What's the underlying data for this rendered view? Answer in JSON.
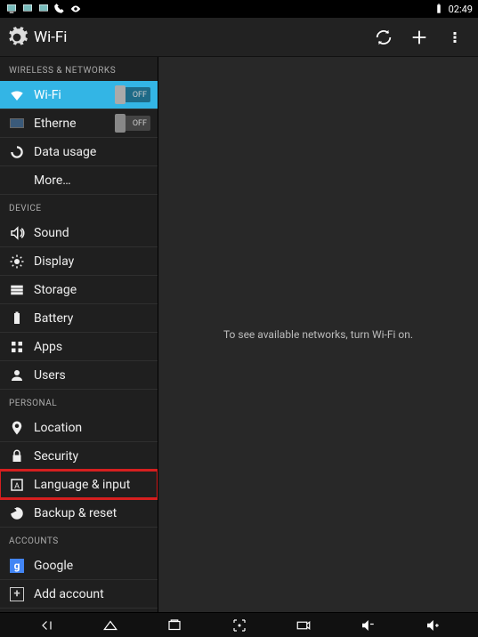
{
  "statusbar": {
    "time": "02:49"
  },
  "actionbar": {
    "title": "Wi-Fi"
  },
  "sidebar": {
    "sections": {
      "wireless": {
        "header": "WIRELESS & NETWORKS",
        "wifi": {
          "label": "Wi-Fi",
          "toggle": "OFF"
        },
        "ethernet": {
          "label": "Etherne",
          "toggle": "OFF"
        },
        "datausage": {
          "label": "Data usage"
        },
        "more": {
          "label": "More…"
        }
      },
      "device": {
        "header": "DEVICE",
        "sound": {
          "label": "Sound"
        },
        "display": {
          "label": "Display"
        },
        "storage": {
          "label": "Storage"
        },
        "battery": {
          "label": "Battery"
        },
        "apps": {
          "label": "Apps"
        },
        "users": {
          "label": "Users"
        }
      },
      "personal": {
        "header": "PERSONAL",
        "location": {
          "label": "Location"
        },
        "security": {
          "label": "Security"
        },
        "language": {
          "label": "Language & input"
        },
        "backup": {
          "label": "Backup & reset"
        }
      },
      "accounts": {
        "header": "ACCOUNTS",
        "google": {
          "label": "Google"
        },
        "add": {
          "label": "Add account"
        }
      }
    }
  },
  "content": {
    "empty_message": "To see available networks, turn Wi-Fi on."
  }
}
